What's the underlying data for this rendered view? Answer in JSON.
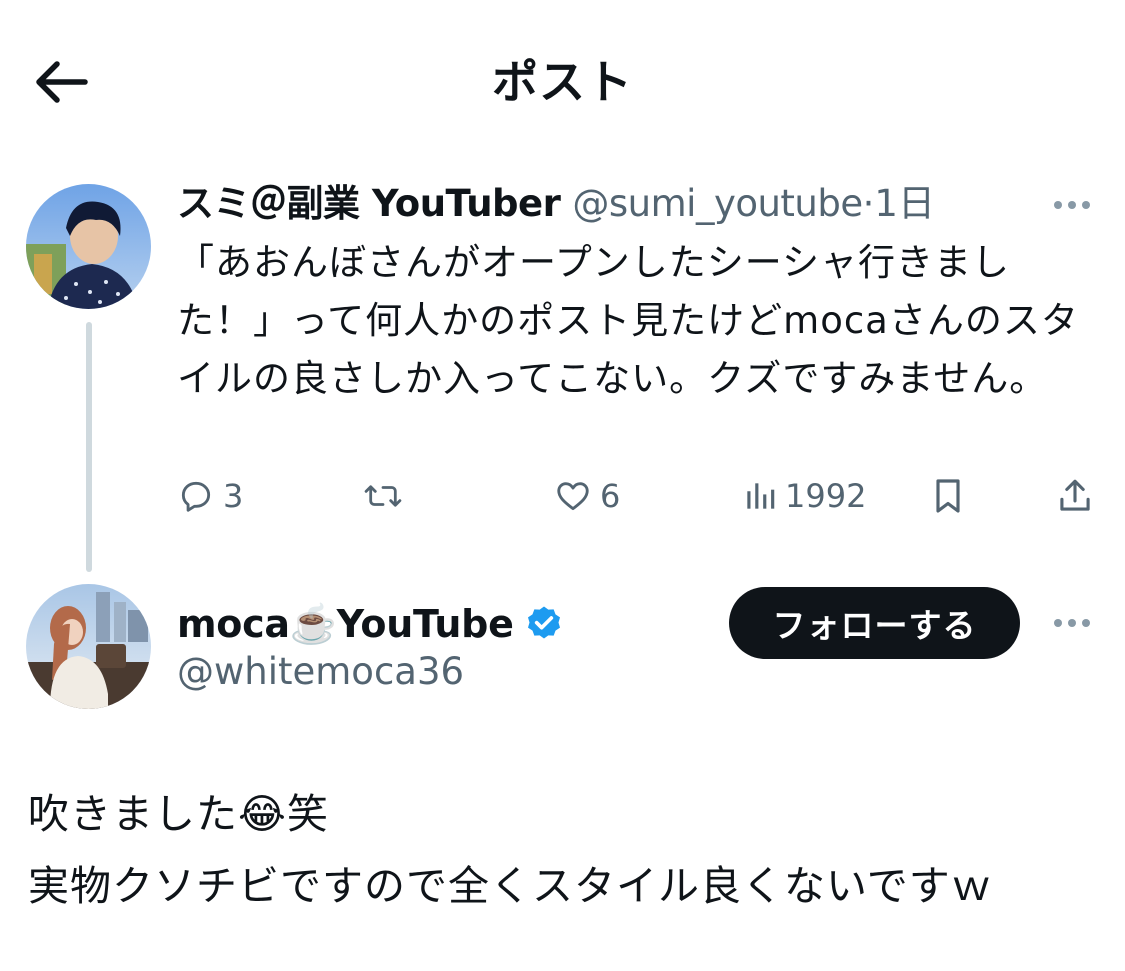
{
  "header": {
    "title": "ポスト"
  },
  "parent_post": {
    "display_name": "スミ＠副業 YouTuber",
    "handle": "@sumi_youtube",
    "separator": "·",
    "time": "1日",
    "text": "「あおんぼさんがオープンしたシーシャ行きました！」って何人かのポスト見たけどmocaさんのスタイルの良さしか入ってこない。クズですみません。",
    "actions": {
      "replies": "3",
      "likes": "6",
      "views": "1992"
    }
  },
  "main_post": {
    "display_name": "moca☕️YouTube",
    "handle": "@whitemoca36",
    "follow_label": "フォローする",
    "text_line1": "吹きました😂笑",
    "text_line2": "実物クソチビですので全くスタイル良くないですｗ"
  },
  "colors": {
    "text": "#0f1419",
    "secondary": "#536471",
    "verified": "#1d9bf0",
    "thread_line": "#cfd9de"
  }
}
